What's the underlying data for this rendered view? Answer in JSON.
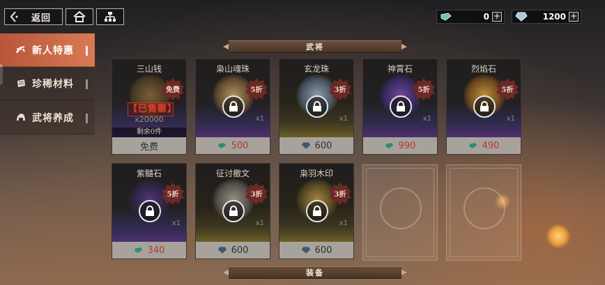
{
  "topbar": {
    "back_label": "返回",
    "home_icon": "home-icon",
    "org_icon": "org-chart-icon"
  },
  "currency": [
    {
      "icon": "jade-currency-icon",
      "amount": "0",
      "plus": "+"
    },
    {
      "icon": "diamond-currency-icon",
      "amount": "1200",
      "plus": "+"
    }
  ],
  "sidebar": {
    "items": [
      {
        "label": "新人特惠",
        "active": true,
        "icon": "gift-icon"
      },
      {
        "label": "珍稀材料",
        "active": false,
        "icon": "scroll-icon"
      },
      {
        "label": "武将养成",
        "active": false,
        "icon": "helmet-icon"
      }
    ]
  },
  "sections": {
    "generals": "武将",
    "equipment": "装备"
  },
  "items": [
    {
      "name": "三山钱",
      "badge": "免费",
      "sold_out": "【已售罄】",
      "quantity": "x20000",
      "remaining": "剩余0件",
      "price": "免费"
    },
    {
      "name": "枭山魂珠",
      "badge": "5折",
      "quantity": "x1",
      "price": "500",
      "price_color": "#b4392b"
    },
    {
      "name": "玄龙珠",
      "badge": "3折",
      "quantity": "x1",
      "price": "600",
      "price_color": "#2d3034"
    },
    {
      "name": "神霄石",
      "badge": "5折",
      "quantity": "x1",
      "price": "990",
      "price_color": "#b4392b"
    },
    {
      "name": "烈焰石",
      "badge": "5折",
      "quantity": "x1",
      "price": "490",
      "price_color": "#b4392b"
    },
    {
      "name": "紫髓石",
      "badge": "5折",
      "quantity": "x1",
      "price": "340",
      "price_color": "#b4392b"
    },
    {
      "name": "征讨檄文",
      "badge": "3折",
      "quantity": "x1",
      "price": "600",
      "price_color": "#2d3034"
    },
    {
      "name": "枭羽木印",
      "badge": "3折",
      "quantity": "x1",
      "price": "600",
      "price_color": "#2d3034"
    }
  ],
  "colors": {
    "accent": "#c9623f",
    "discount_badge": "#7a2a22",
    "sold_out": "#e33a2a"
  }
}
